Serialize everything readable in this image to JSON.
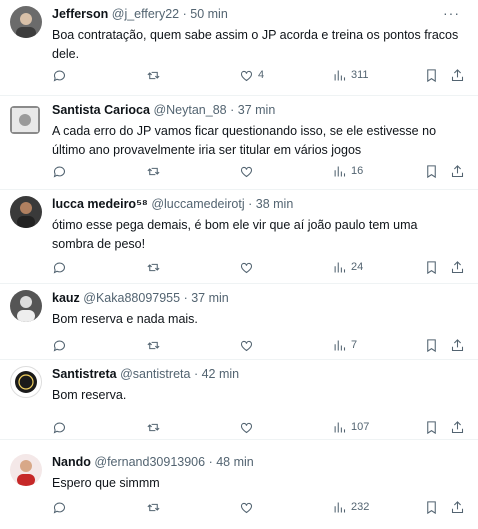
{
  "tweets": [
    {
      "name": "Jefferson",
      "handle": "@j_effery22",
      "time": "50 min",
      "text": "Boa contratação, quem sabe assim o JP acorda e treina os pontos fracos dele.",
      "likes": "4",
      "views": "311",
      "avatar_color": "#6b6b6b"
    },
    {
      "name": "Santista Carioca",
      "handle": "@Neytan_88",
      "time": "37 min",
      "text": "A cada erro do JP vamos ficar questionando isso, se ele estivesse no último ano provavelmente iria ser titular em vários jogos",
      "likes": "",
      "views": "16",
      "avatar_color": "#8a8a8a"
    },
    {
      "name": "lucca medeiro⁵⁸",
      "handle": "@luccamedeirotj",
      "time": "38 min",
      "text": "ótimo esse pega demais, é bom ele vir que aí joão paulo tem uma sombra de peso!",
      "likes": "",
      "views": "24",
      "avatar_color": "#3a3a3a"
    },
    {
      "name": "kauz",
      "handle": "@Kaka88097955",
      "time": "37 min",
      "text": "Bom reserva e nada mais.",
      "likes": "",
      "views": "7",
      "avatar_color": "#555555"
    },
    {
      "name": "Santistreta",
      "handle": "@santistreta",
      "time": "42 min",
      "text": "Bom reserva.",
      "likes": "",
      "views": "107",
      "avatar_color": "#1a1a1a"
    },
    {
      "name": "Nando",
      "handle": "@fernand30913906",
      "time": "48 min",
      "text": "Espero que simmm",
      "likes": "",
      "views": "232",
      "avatar_color": "#c62828"
    }
  ],
  "ui": {
    "separator": "·",
    "more": "···"
  },
  "colors": {
    "text": "#0f1419",
    "muted": "#536471",
    "border": "#eff3f4"
  }
}
